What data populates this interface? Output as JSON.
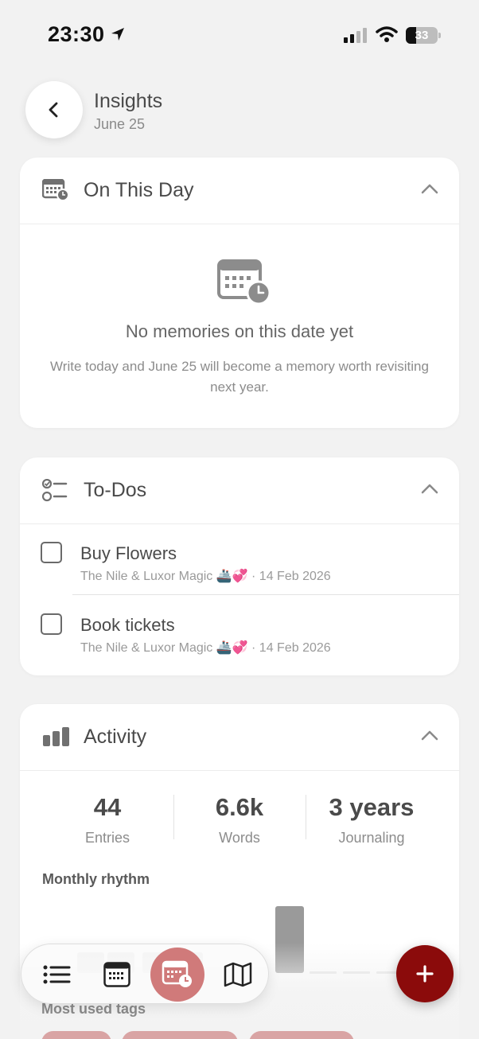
{
  "status_bar": {
    "time": "23:30",
    "battery": "33",
    "battery_level_percent": 33,
    "icons": [
      "location-arrow-icon",
      "signal-icon",
      "wifi-icon",
      "battery-icon"
    ]
  },
  "header": {
    "title": "Insights",
    "subtitle": "June 25",
    "back_icon": "chevron-left-icon"
  },
  "on_this_day": {
    "title": "On This Day",
    "icon": "calendar-clock-icon",
    "empty_title": "No memories on this date yet",
    "empty_body": "Write today and June 25 will become a memory worth revisiting next year."
  },
  "todos": {
    "title": "To-Dos",
    "icon": "checklist-icon",
    "items": [
      {
        "title": "Buy Flowers",
        "journal": "The Nile & Luxor Magic 🚢💞",
        "date": "· 14 Feb 2026",
        "checked": false
      },
      {
        "title": "Book tickets",
        "journal": "The Nile & Luxor Magic 🚢💞",
        "date": "· 14 Feb 2026",
        "checked": false
      }
    ]
  },
  "activity": {
    "title": "Activity",
    "icon": "bar-chart-icon",
    "stats": [
      {
        "value": "44",
        "label": "Entries"
      },
      {
        "value": "6.6k",
        "label": "Words"
      },
      {
        "value": "3 years",
        "label": "Journaling"
      }
    ],
    "rhythm_label": "Monthly rhythm",
    "tags_label": "Most used tags"
  },
  "chart_data": {
    "type": "bar",
    "title": "Monthly rhythm",
    "categories": [],
    "values": [],
    "note_visible": "one tall bar and several near-zero bars"
  },
  "tab_bar": {
    "tabs": [
      {
        "name": "list",
        "icon": "list-icon",
        "active": false
      },
      {
        "name": "calendar",
        "icon": "calendar-icon",
        "active": false
      },
      {
        "name": "insights",
        "icon": "calendar-clock-icon",
        "active": true
      },
      {
        "name": "map",
        "icon": "map-icon",
        "active": false
      }
    ],
    "fab_icon": "plus-icon"
  },
  "colors": {
    "accent": "#8b0b0b",
    "active_tab": "#d07a7a",
    "background": "#f2f2f2",
    "card": "#ffffff",
    "tag_pill": "#d9a4a4"
  }
}
